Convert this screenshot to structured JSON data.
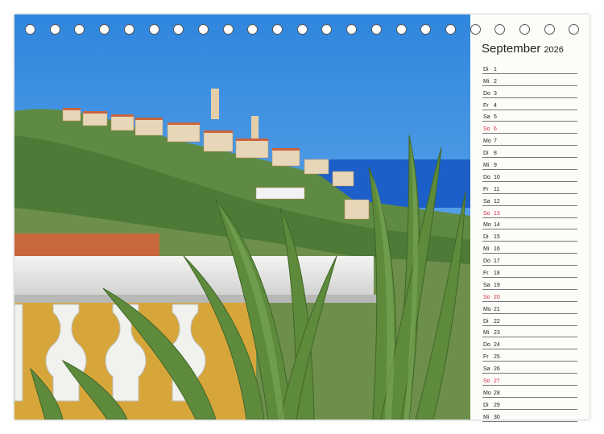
{
  "calendar": {
    "month": "September",
    "year": "2026",
    "days": [
      {
        "wd": "Di",
        "n": "1"
      },
      {
        "wd": "Mi",
        "n": "2"
      },
      {
        "wd": "Do",
        "n": "3"
      },
      {
        "wd": "Fr",
        "n": "4"
      },
      {
        "wd": "Sa",
        "n": "5"
      },
      {
        "wd": "So",
        "n": "6"
      },
      {
        "wd": "Mo",
        "n": "7"
      },
      {
        "wd": "Di",
        "n": "8"
      },
      {
        "wd": "Mi",
        "n": "9"
      },
      {
        "wd": "Do",
        "n": "10"
      },
      {
        "wd": "Fr",
        "n": "11"
      },
      {
        "wd": "Sa",
        "n": "12"
      },
      {
        "wd": "So",
        "n": "13"
      },
      {
        "wd": "Mo",
        "n": "14"
      },
      {
        "wd": "Di",
        "n": "15"
      },
      {
        "wd": "Mi",
        "n": "16"
      },
      {
        "wd": "Do",
        "n": "17"
      },
      {
        "wd": "Fr",
        "n": "18"
      },
      {
        "wd": "Sa",
        "n": "19"
      },
      {
        "wd": "So",
        "n": "20"
      },
      {
        "wd": "Mo",
        "n": "21"
      },
      {
        "wd": "Di",
        "n": "22"
      },
      {
        "wd": "Mi",
        "n": "23"
      },
      {
        "wd": "Do",
        "n": "24"
      },
      {
        "wd": "Fr",
        "n": "25"
      },
      {
        "wd": "Sa",
        "n": "26"
      },
      {
        "wd": "So",
        "n": "27"
      },
      {
        "wd": "Mo",
        "n": "28"
      },
      {
        "wd": "Di",
        "n": "29"
      },
      {
        "wd": "Mi",
        "n": "30"
      }
    ]
  },
  "colors": {
    "sunday": "#d0304a",
    "sky": "#3b8fe0",
    "sea": "#1d5fc9"
  },
  "binding": {
    "ring_count": 23
  }
}
